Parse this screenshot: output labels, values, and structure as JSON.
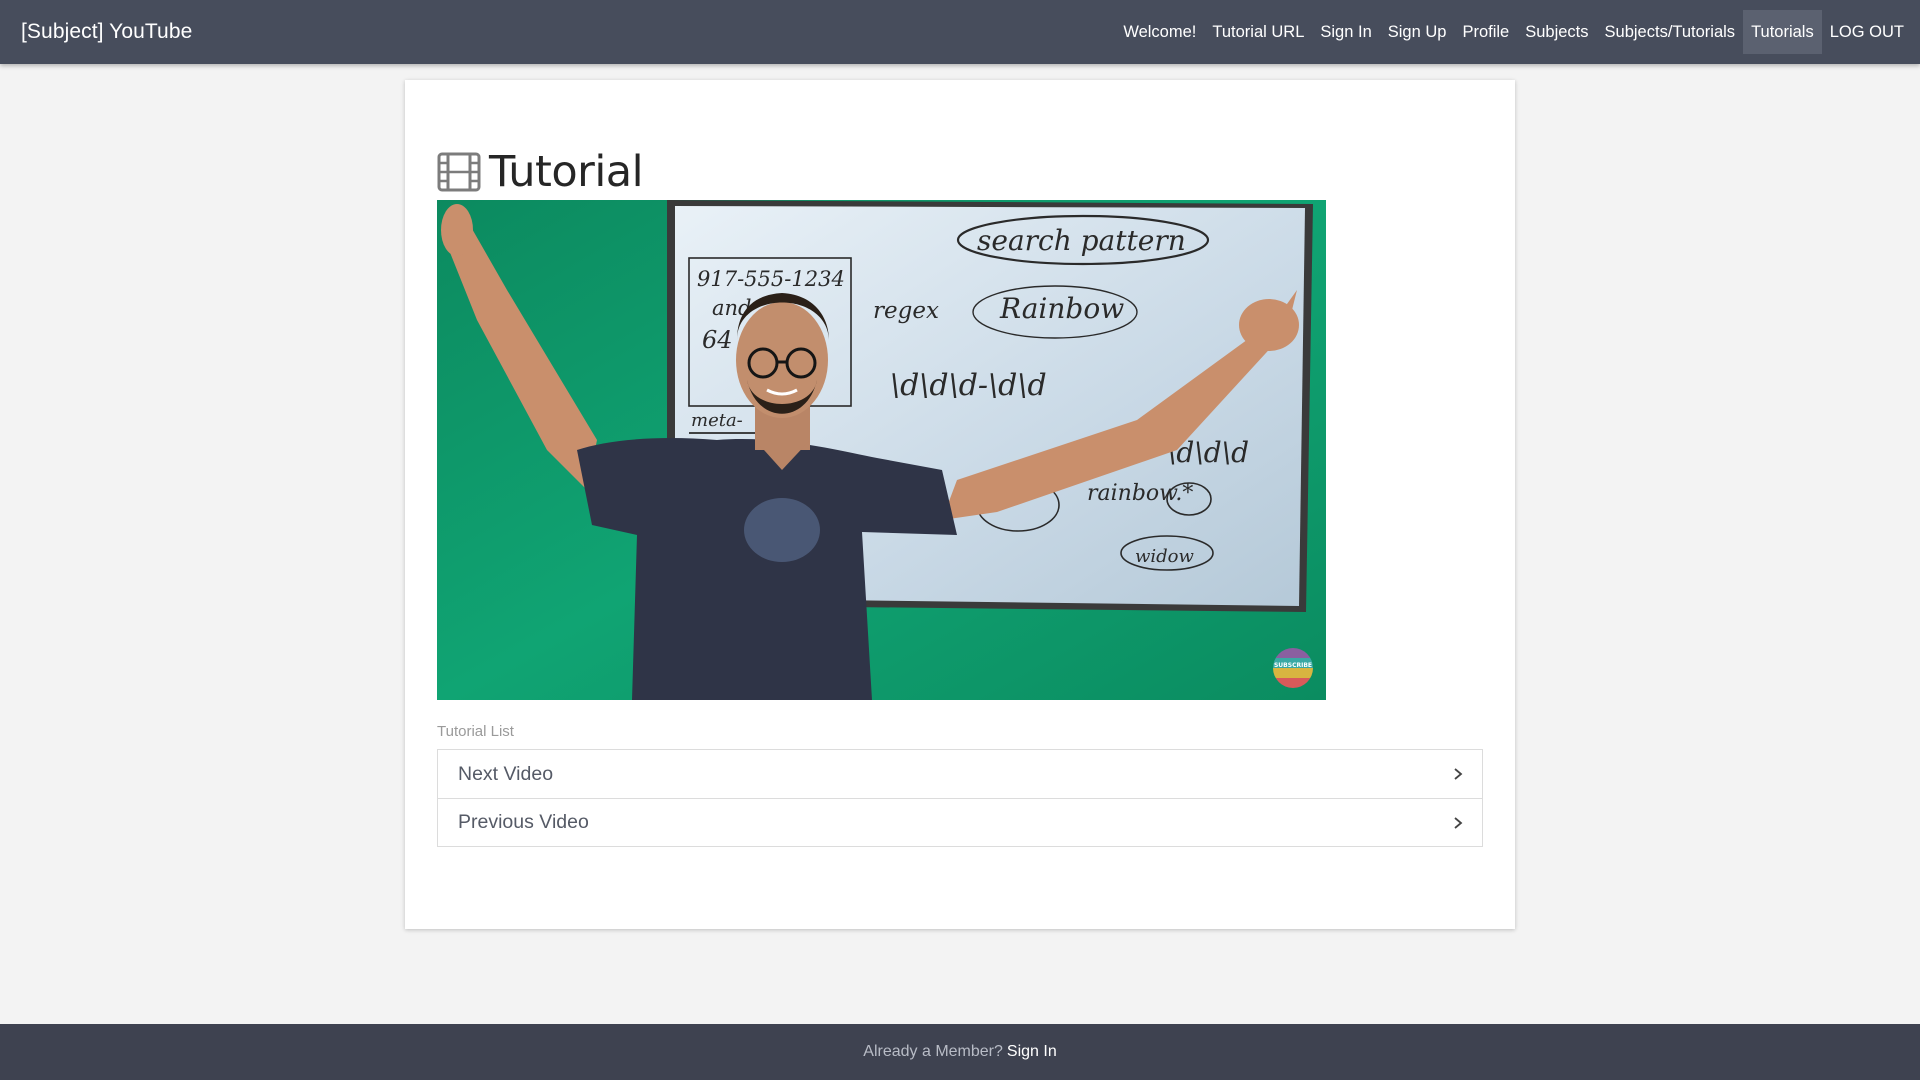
{
  "navbar": {
    "brand": "[Subject] YouTube",
    "links": [
      {
        "label": "Welcome!",
        "active": false
      },
      {
        "label": "Tutorial URL",
        "active": false
      },
      {
        "label": "Sign In",
        "active": false
      },
      {
        "label": "Sign Up",
        "active": false
      },
      {
        "label": "Profile",
        "active": false
      },
      {
        "label": "Subjects",
        "active": false
      },
      {
        "label": "Subjects/Tutorials",
        "active": false
      },
      {
        "label": "Tutorials",
        "active": true
      },
      {
        "label": "LOG OUT",
        "active": false
      }
    ]
  },
  "main": {
    "title": "Tutorial",
    "title_icon": "film-icon",
    "video": {
      "whiteboard_text": [
        "search pattern",
        "917-555-1234",
        "and",
        "64",
        "regex",
        "Rainbow",
        "\\d\\d\\d-\\d\\d",
        "\\d\\d\\d",
        "meta-",
        "rainbow.*",
        ".*",
        "widow"
      ],
      "badge_text": "SUBSCRIBE"
    },
    "list_label": "Tutorial List",
    "list_items": [
      {
        "label": "Next Video",
        "icon": "chevron-right-icon"
      },
      {
        "label": "Previous Video",
        "icon": "chevron-right-icon"
      }
    ]
  },
  "footer": {
    "text": "Already a Member?",
    "link": "Sign In"
  },
  "colors": {
    "navbar": "#474d5c",
    "navbar_active": "#5b6170",
    "footer": "#3e4250",
    "page_bg": "#f3f3f3",
    "video_green": "#0f9c6e"
  }
}
